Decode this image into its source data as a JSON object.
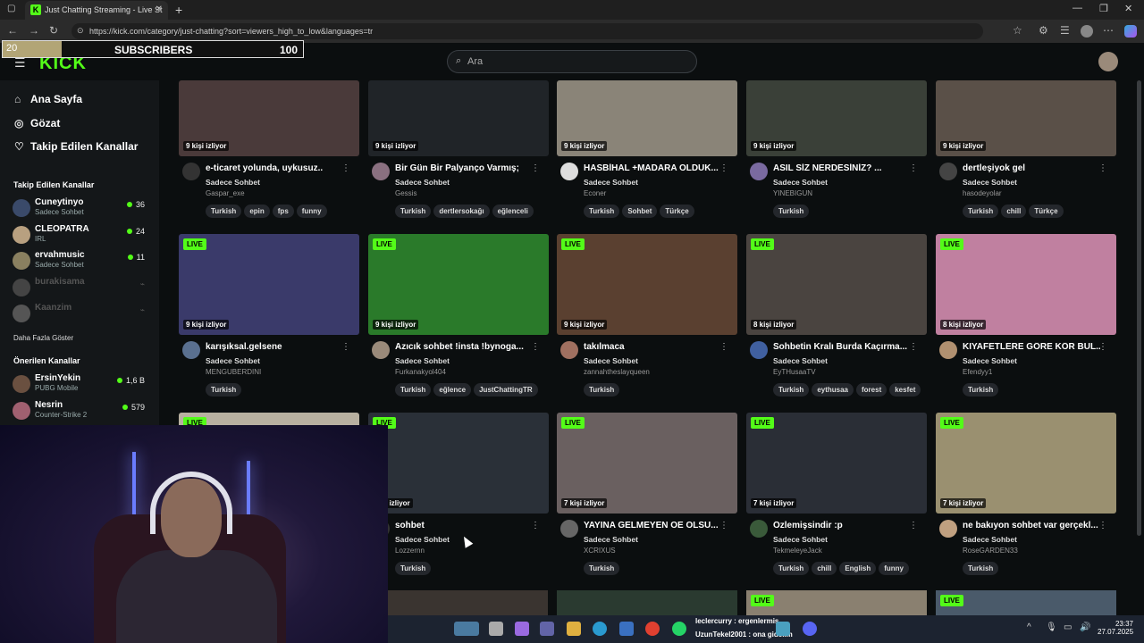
{
  "browser": {
    "tab_title": "Just Chatting Streaming - Live St",
    "favicon": "K",
    "url": "https://kick.com/category/just-chatting?sort=viewers_high_to_low&languages=tr"
  },
  "overlay": {
    "sub_count": "20",
    "label": "SUBSCRIBERS",
    "goal": "100"
  },
  "header": {
    "logo": "KICK",
    "search_placeholder": "Ara"
  },
  "sidebar": {
    "nav": [
      {
        "icon": "home-icon",
        "label": "Ana Sayfa"
      },
      {
        "icon": "compass-icon",
        "label": "Gözat"
      },
      {
        "icon": "heart-icon",
        "label": "Takip Edilen Kanallar"
      }
    ],
    "followed_heading": "Takip Edilen Kanallar",
    "followed": [
      {
        "name": "Cuneytinyo",
        "category": "Sadece Sohbet",
        "viewers": "36",
        "color": "#3a4a6a"
      },
      {
        "name": "CLEOPATRA",
        "category": "IRL",
        "viewers": "24",
        "color": "#b8a080"
      },
      {
        "name": "ervahmusic",
        "category": "Sadece Sohbet",
        "viewers": "11",
        "color": "#8a8060"
      },
      {
        "name": "burakisama",
        "category": "",
        "viewers": "",
        "color": "#444"
      },
      {
        "name": "Kaanzim",
        "category": "",
        "viewers": "",
        "color": "#555"
      }
    ],
    "show_more": "Daha Fazla Göster",
    "recommended_heading": "Önerilen Kanallar",
    "recommended": [
      {
        "name": "ErsinYekin",
        "category": "PUBG Mobile",
        "viewers": "1,6 B",
        "color": "#6a5040"
      },
      {
        "name": "Nesrin",
        "category": "Counter-Strike 2",
        "viewers": "579",
        "color": "#a06070"
      }
    ]
  },
  "cards": [
    {
      "live": "",
      "viewers": "9 kişi izliyor",
      "title": "e-ticaret yolunda, uykusuz..",
      "category": "Sadece Sohbet",
      "user": "Gaspar_exe",
      "tags": [
        "Turkish",
        "epin",
        "fps",
        "funny"
      ],
      "thumb": "#4a3a3a",
      "av": "#333"
    },
    {
      "live": "",
      "viewers": "9 kişi izliyor",
      "title": "Bir Gün Bir Palyanço Varmış;",
      "category": "Sadece Sohbet",
      "user": "Gessis",
      "tags": [
        "Turkish",
        "dertlersokağı",
        "eğlenceli"
      ],
      "thumb": "#202428",
      "av": "#8a7080"
    },
    {
      "live": "",
      "viewers": "9 kişi izliyor",
      "title": "HASBİHAL +MADARA OLDUK...",
      "category": "Sadece Sohbet",
      "user": "Econer",
      "tags": [
        "Turkish",
        "Sohbet",
        "Türkçe"
      ],
      "thumb": "#8a8478",
      "av": "#ddd"
    },
    {
      "live": "",
      "viewers": "9 kişi izliyor",
      "title": "ASIL SİZ NERDESİNİZ? ...",
      "category": "Sadece Sohbet",
      "user": "YINEBIGUN",
      "tags": [
        "Turkish"
      ],
      "thumb": "#3a4038",
      "av": "#7a6aa0"
    },
    {
      "live": "",
      "viewers": "9 kişi izliyor",
      "title": "dertleşiyok gel",
      "category": "Sadece Sohbet",
      "user": "hasodeyolar",
      "tags": [
        "Turkish",
        "chill",
        "Türkçe"
      ],
      "thumb": "#5a5048",
      "av": "#444"
    },
    {
      "live": "LIVE",
      "viewers": "9 kişi izliyor",
      "title": "karışıksal.gelsene",
      "category": "Sadece Sohbet",
      "user": "MENGUBERDINI",
      "tags": [
        "Turkish"
      ],
      "thumb": "#3a3a6a",
      "av": "#5a7090"
    },
    {
      "live": "LIVE",
      "viewers": "9 kişi izliyor",
      "title": "Azıcık sohbet !insta !bynoga...",
      "category": "Sadece Sohbet",
      "user": "Furkanakyol404",
      "tags": [
        "Turkish",
        "eğlence",
        "JustChattingTR"
      ],
      "thumb": "#2a7a2a",
      "av": "#9a8a7a"
    },
    {
      "live": "LIVE",
      "viewers": "9 kişi izliyor",
      "title": "takılmaca",
      "category": "Sadece Sohbet",
      "user": "zannahtheslayqueen",
      "tags": [
        "Turkish"
      ],
      "thumb": "#5a4030",
      "av": "#a07060"
    },
    {
      "live": "LIVE",
      "viewers": "8 kişi izliyor",
      "title": "Sohbetin Kralı Burda Kaçırma...",
      "category": "Sadece Sohbet",
      "user": "EyTHusaaTV",
      "tags": [
        "Turkish",
        "eythusaa",
        "forest",
        "kesfet"
      ],
      "thumb": "#4a4440",
      "av": "#4060a0"
    },
    {
      "live": "LIVE",
      "viewers": "8 kişi izliyor",
      "title": "KIYAFETLERE GÖRE KÖR BUL...",
      "category": "Sadece Sohbet",
      "user": "Efendyy1",
      "tags": [
        "Turkish"
      ],
      "thumb": "#c080a0",
      "av": "#b09070"
    },
    {
      "live": "LIVE",
      "viewers": "",
      "title": "",
      "category": "",
      "user": "",
      "tags": [],
      "thumb": "#b8b0a0",
      "av": "#000"
    },
    {
      "live": "LIVE",
      "viewers": "kişi izliyor",
      "title": "sohbet",
      "category": "Sadece Sohbet",
      "user": "Lozzernn",
      "tags": [
        "Turkish"
      ],
      "thumb": "#2a3038",
      "av": "#333"
    },
    {
      "live": "LIVE",
      "viewers": "7 kişi izliyor",
      "title": "YAYINA GELMEYEN OE OLSU...",
      "category": "Sadece Sohbet",
      "user": "XCRIXUS",
      "tags": [
        "Turkish"
      ],
      "thumb": "#6a6060",
      "av": "#666"
    },
    {
      "live": "LIVE",
      "viewers": "7 kişi izliyor",
      "title": "Özlemişsindir :p",
      "category": "Sadece Sohbet",
      "user": "TekmeleyeJack",
      "tags": [
        "Turkish",
        "chill",
        "English",
        "funny"
      ],
      "thumb": "#2a2e36",
      "av": "#3a5a3a"
    },
    {
      "live": "LIVE",
      "viewers": "7 kişi izliyor",
      "title": "ne bakıyon sohbet var gerçekl...",
      "category": "Sadece Sohbet",
      "user": "RoseGARDEN33",
      "tags": [
        "Turkish"
      ],
      "thumb": "#9a9070",
      "av": "#c0a080"
    }
  ],
  "bottom_row_live": [
    "LIVE",
    "LIVE",
    "LIVE"
  ],
  "taskbar": {
    "chat_line1": "leclercurry : ergenlermiş",
    "chat_line2": "UzunTekel2001 : ona gidelim",
    "time": "23:37",
    "date": "27.07.2025"
  }
}
